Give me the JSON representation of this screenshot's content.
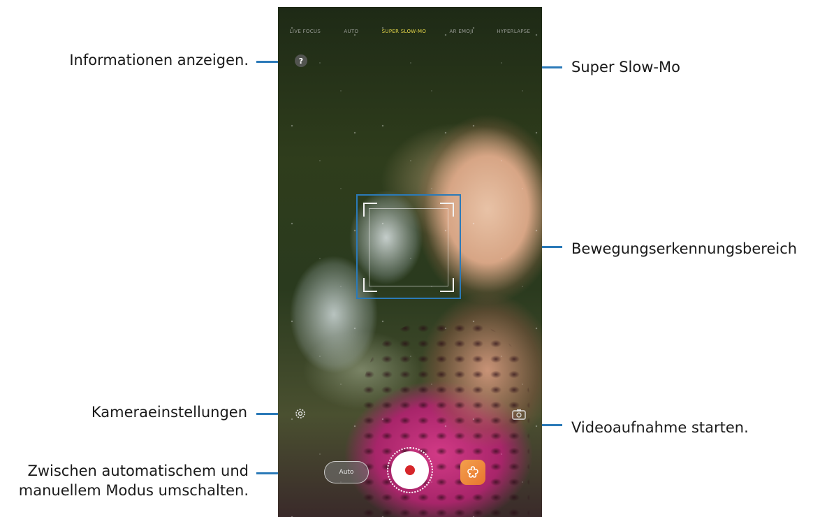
{
  "callouts": {
    "info": "Informationen anzeigen.",
    "super_slow_mo": "Super Slow-Mo",
    "motion_area": "Bewegungserkennungsbereich",
    "camera_settings": "Kameraeinstellungen",
    "start_recording": "Videoaufnahme starten.",
    "mode_switch_line1": "Zwischen automatischem und",
    "mode_switch_line2": "manuellem Modus umschalten."
  },
  "camera": {
    "modes": [
      "LIVE FOCUS",
      "AUTO",
      "SUPER SLOW-MO",
      "AR EMOJI",
      "HYPERLAPSE"
    ],
    "active_mode_index": 2,
    "help_label": "?",
    "auto_toggle_label": "Auto",
    "icons": {
      "help": "question-icon",
      "settings": "gear-icon",
      "switch_camera": "switch-camera-icon",
      "record": "record-icon",
      "effects": "flower-icon"
    },
    "colors": {
      "callout_line": "#2b7ab8",
      "active_mode": "#e7d84b",
      "record_dot": "#d6262a",
      "effects_button": "#e8752f"
    }
  }
}
